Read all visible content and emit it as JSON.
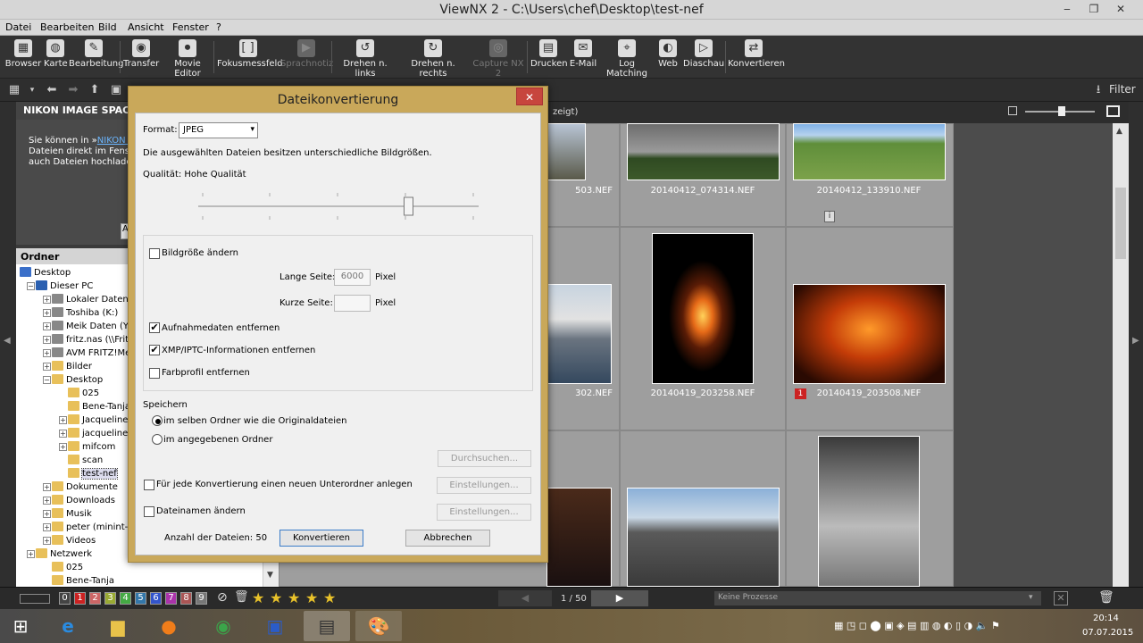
{
  "window": {
    "title": "ViewNX 2 - C:\\Users\\chef\\Desktop\\test-nef"
  },
  "menu": [
    "Datei",
    "Bearbeiten",
    "Bild",
    "Ansicht",
    "Fenster",
    "?"
  ],
  "toolbar": [
    {
      "label": "Browser",
      "icon": "browser-icon",
      "enabled": true
    },
    {
      "label": "Karte",
      "icon": "globe-icon",
      "enabled": true
    },
    {
      "label": "Bearbeitung",
      "icon": "edit-icon",
      "enabled": true
    },
    {
      "label": "Transfer",
      "icon": "camera-icon",
      "enabled": true
    },
    {
      "label": "Movie Editor",
      "icon": "film-icon",
      "enabled": true
    },
    {
      "label": "Fokusmessfeld",
      "icon": "focus-icon",
      "enabled": true
    },
    {
      "label": "Sprachnotiz",
      "icon": "voice-icon",
      "enabled": false
    },
    {
      "label": "Drehen n. links",
      "icon": "rotate-left-icon",
      "enabled": true
    },
    {
      "label": "Drehen n. rechts",
      "icon": "rotate-right-icon",
      "enabled": true
    },
    {
      "label": "Capture NX 2",
      "icon": "capture-icon",
      "enabled": false
    },
    {
      "label": "Drucken",
      "icon": "printer-icon",
      "enabled": true
    },
    {
      "label": "E-Mail",
      "icon": "mail-icon",
      "enabled": true
    },
    {
      "label": "Log Matching",
      "icon": "log-icon",
      "enabled": true
    },
    {
      "label": "Web",
      "icon": "web-icon",
      "enabled": true
    },
    {
      "label": "Diaschau",
      "icon": "slideshow-icon",
      "enabled": true
    },
    {
      "label": "Konvertieren",
      "icon": "convert-icon",
      "enabled": true
    }
  ],
  "subtoolbar": {
    "filter_label": "Filter",
    "count_fragment": "zeigt)"
  },
  "nis": {
    "title": "NIKON IMAGE SPACE",
    "text_pre": "Sie können in »",
    "link": "NIKON IM",
    "line2": "Dateien direkt im Fenster",
    "line3": "auch Dateien hochladen.",
    "button": "A"
  },
  "folders": {
    "title": "Ordner",
    "items": [
      {
        "label": "Desktop",
        "expander": ""
      },
      {
        "label": "Dieser PC",
        "expander": "-"
      },
      {
        "label": "Lokaler Datentr",
        "expander": "+"
      },
      {
        "label": "Toshiba (K:)",
        "expander": "+"
      },
      {
        "label": "Meik Daten (Y:",
        "expander": "+"
      },
      {
        "label": "fritz.nas (\\\\Fritz",
        "expander": "+"
      },
      {
        "label": "AVM FRITZ!Me",
        "expander": "+"
      },
      {
        "label": "Bilder",
        "expander": "+"
      },
      {
        "label": "Desktop",
        "expander": "-"
      },
      {
        "label": "025",
        "expander": ""
      },
      {
        "label": "Bene-Tanja",
        "expander": ""
      },
      {
        "label": "Jacqueline",
        "expander": "+"
      },
      {
        "label": "jacqueline_",
        "expander": "+"
      },
      {
        "label": "mifcom",
        "expander": "+"
      },
      {
        "label": "scan",
        "expander": ""
      },
      {
        "label": "test-nef",
        "expander": ""
      },
      {
        "label": "Dokumente",
        "expander": "+"
      },
      {
        "label": "Downloads",
        "expander": "+"
      },
      {
        "label": "Musik",
        "expander": "+"
      },
      {
        "label": "peter (minint-mu",
        "expander": "+"
      },
      {
        "label": "Videos",
        "expander": "+"
      },
      {
        "label": "Netzwerk",
        "expander": "+"
      },
      {
        "label": "025",
        "expander": ""
      },
      {
        "label": "Bene-Tanja",
        "expander": ""
      }
    ]
  },
  "thumbs": [
    {
      "name": "503.NEF",
      "label": ""
    },
    {
      "name": "20140412_074314.NEF",
      "label": ""
    },
    {
      "name": "20140412_133910.NEF",
      "label": ""
    },
    {
      "name": "302.NEF",
      "label": ""
    },
    {
      "name": "20140419_203258.NEF",
      "label": ""
    },
    {
      "name": "20140419_203508.NEF",
      "label": "1"
    }
  ],
  "status": {
    "labels": [
      "0",
      "1",
      "2",
      "3",
      "4",
      "5",
      "6",
      "7",
      "8",
      "9"
    ],
    "label_colors": [
      "#444",
      "#c22",
      "#c66",
      "#9a3",
      "#4a4",
      "#37a",
      "#35c",
      "#a3a",
      "#a55",
      "#777"
    ],
    "page": "1 / 50",
    "process": "Keine Prozesse"
  },
  "taskbar": {
    "time": "20:14",
    "date": "07.07.2015"
  },
  "dialog": {
    "title": "Dateikonvertierung",
    "format_label": "Format:",
    "format_value": "JPEG",
    "sizes_note": "Die ausgewählten Dateien besitzen unterschiedliche Bildgrößen.",
    "quality_label": "Qualität: Hohe Qualität",
    "quality_level": 0.75,
    "resize_label": "Bildgröße ändern",
    "resize_checked": false,
    "long_side_label": "Lange Seite:",
    "long_side_value": "6000",
    "short_side_label": "Kurze Seite:",
    "short_side_value": "",
    "pixel": "Pixel",
    "remove_exif_label": "Aufnahmedaten entfernen",
    "remove_exif_checked": true,
    "remove_xmp_label": "XMP/IPTC-Informationen entfernen",
    "remove_xmp_checked": true,
    "remove_profile_label": "Farbprofil entfernen",
    "remove_profile_checked": false,
    "save_heading": "Speichern",
    "same_folder_label": "im selben Ordner wie die Originaldateien",
    "other_folder_label": "im angegebenen Ordner",
    "browse_label": "Durchsuchen...",
    "subfolder_label": "Für jede Konvertierung einen neuen Unterordner anlegen",
    "settings_label": "Einstellungen...",
    "rename_label": "Dateinamen ändern",
    "file_count_label": "Anzahl der Dateien: 50",
    "convert_label": "Konvertieren",
    "cancel_label": "Abbrechen"
  }
}
